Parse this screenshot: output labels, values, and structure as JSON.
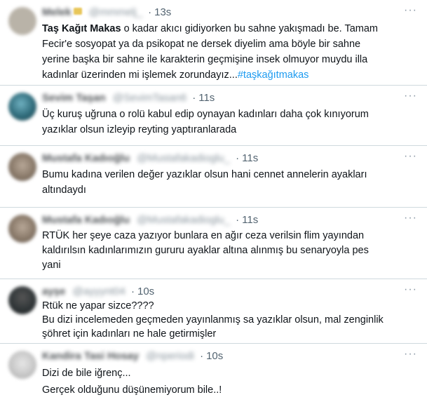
{
  "tweets": [
    {
      "name": "Melek",
      "handle": "@mmmelj_",
      "time": "13s",
      "text_bold": "Taş Kağıt Makas",
      "text": " o kadar akıcı gidiyorken bu sahne yakışmadı be. Tamam\nFecir'e sosyopat ya da psikopat ne dersek diyelim ama böyle bir sahne\nyerine başka bir sahne ile karakterin geçmişine insek olmuyor muydu illa\nkadınlar üzerinden mi işlemek zorundayız...",
      "hashtag": "#taşkağıtmakas",
      "avatar_color": "#b9b3a8"
    },
    {
      "name": "Sevim Taşan",
      "handle": "@SevimTasan6",
      "time": "11s",
      "text": "Üç kuruş uğruna o rolü kabul edip oynayan kadınları daha çok kınıyorum\nyazıklar olsun izleyip reyting yaptıranlarada",
      "avatar_color": "#2f6b7a"
    },
    {
      "name": "Mustafa Kadıoğlu",
      "handle": "@Mustafakadioglu_",
      "time": "11s",
      "text": "Bumu kadına verilen değer yazıklar olsun hani cennet annelerin ayakları\naltındaydı",
      "avatar_color": "#8a7a6a"
    },
    {
      "name": "Mustafa Kadıoğlu",
      "handle": "@Mustafakadioglu_",
      "time": "11s",
      "text": "RTÜK her şeye caza yazıyor bunlara en ağır ceza verilsin flim yayından\nkaldırılsın kadınlarımızın gururu ayaklar altına alınmış bu senaryoyla pes\nyani",
      "avatar_color": "#8a7a6a"
    },
    {
      "name": "ayşe",
      "handle": "@ayyynt04",
      "time": "10s",
      "text": "Rtük ne yapar sizce????\nBu dizi incelemeden geçmeden yayınlanmış sa yazıklar olsun, mal zenginlik\nşöhret için kadınları ne hale getirmişler",
      "avatar_color": "#2e3436"
    },
    {
      "name": "Kandira Tasi Hosay",
      "handle": "@nperiodi",
      "time": "10s",
      "text": "Dizi de bile iğrenç...\nGerçek olduğunu düşünemiyorum bile..!",
      "avatar_color": "#c8c8c8"
    }
  ],
  "more_label": "···"
}
